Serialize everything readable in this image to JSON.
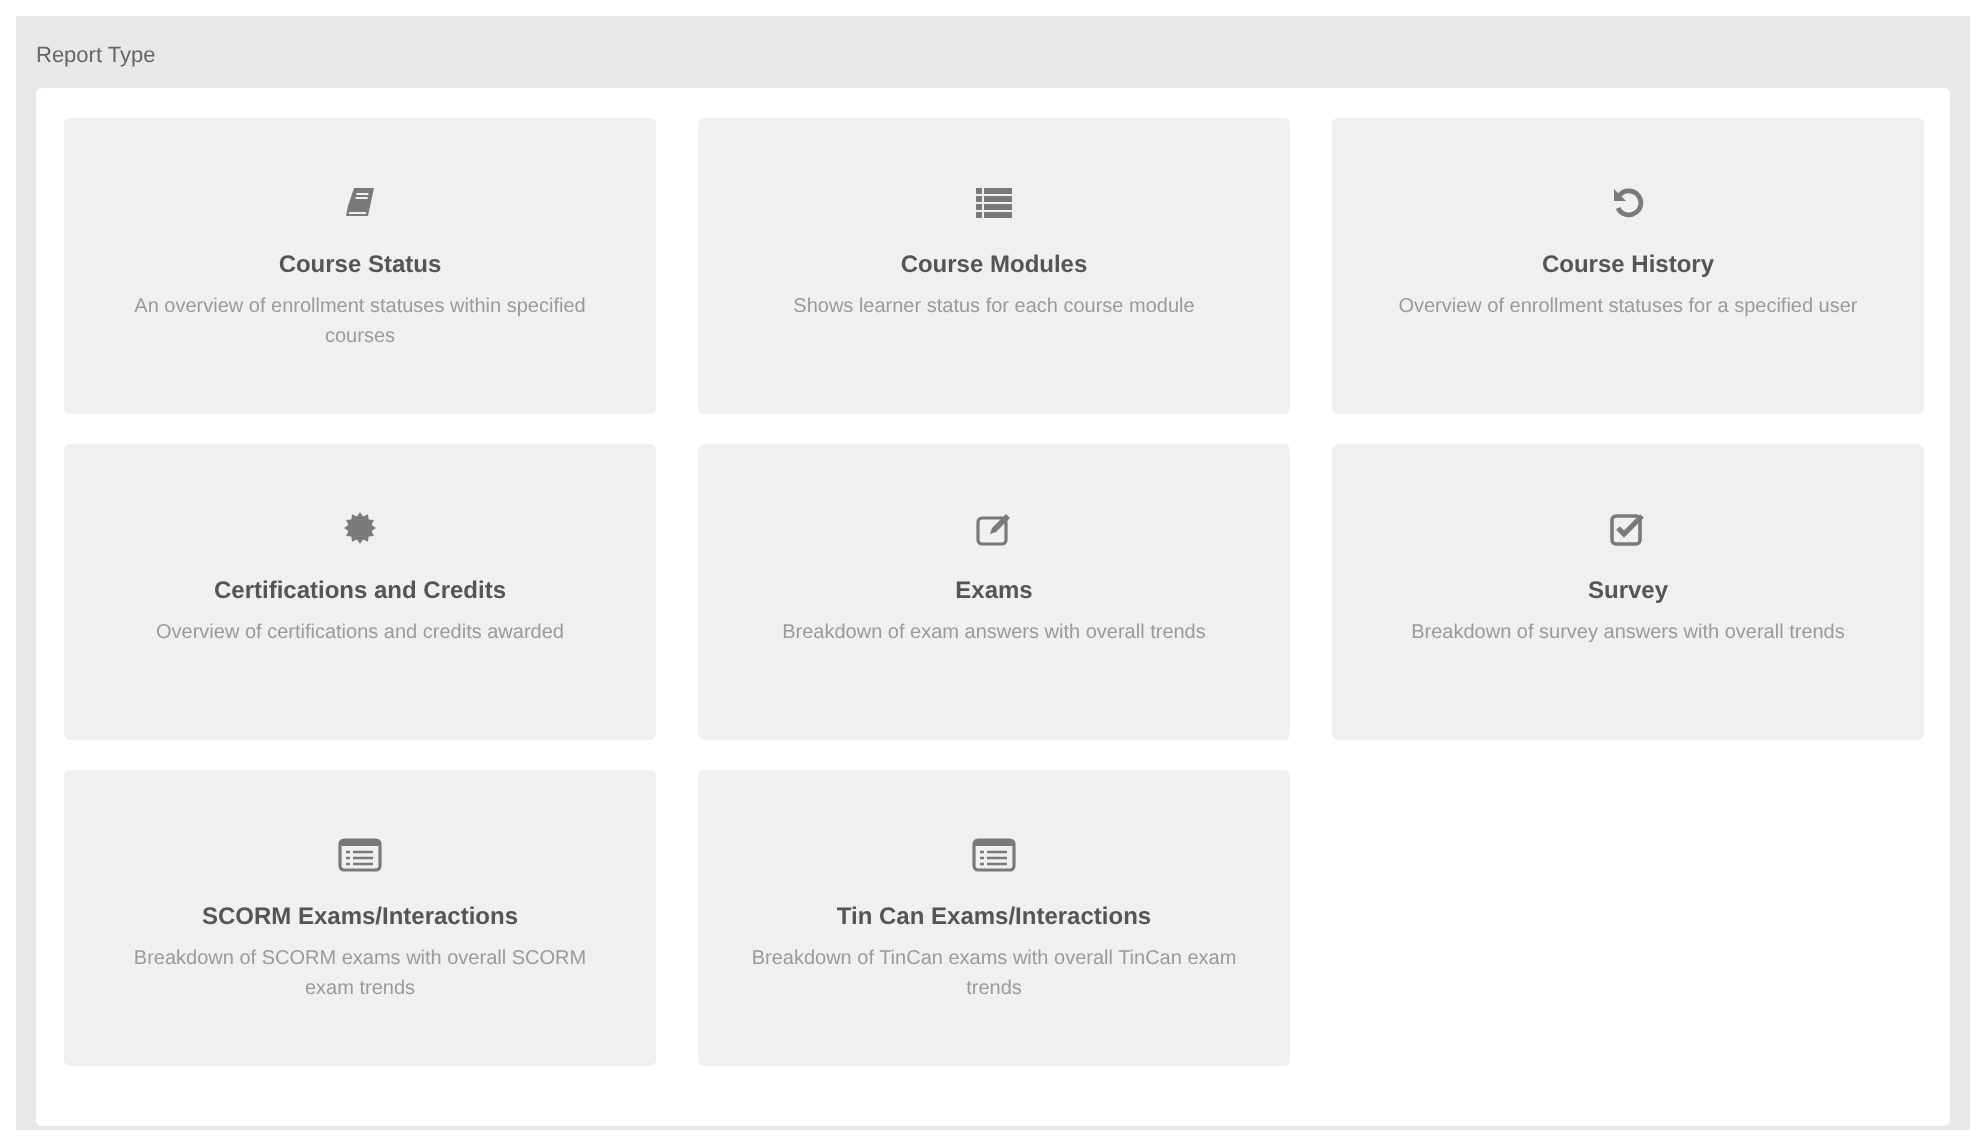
{
  "section_title": "Report Type",
  "report_types": [
    {
      "kind": "book",
      "title": "Course Status",
      "description": "An overview of enrollment statuses within specified courses"
    },
    {
      "kind": "list",
      "title": "Course Modules",
      "description": "Shows learner status for each course module"
    },
    {
      "kind": "history",
      "title": "Course History",
      "description": "Overview of enrollment statuses for a specified user"
    },
    {
      "kind": "badge",
      "title": "Certifications and Credits",
      "description": "Overview of certifications and credits awarded"
    },
    {
      "kind": "edit",
      "title": "Exams",
      "description": "Breakdown of exam answers with overall trends"
    },
    {
      "kind": "check",
      "title": "Survey",
      "description": "Breakdown of survey answers with overall trends"
    },
    {
      "kind": "window",
      "title": "SCORM Exams/Interactions",
      "description": "Breakdown of SCORM exams with overall SCORM exam trends"
    },
    {
      "kind": "window",
      "title": "Tin Can Exams/Interactions",
      "description": "Breakdown of TinCan exams with overall TinCan exam trends"
    }
  ]
}
